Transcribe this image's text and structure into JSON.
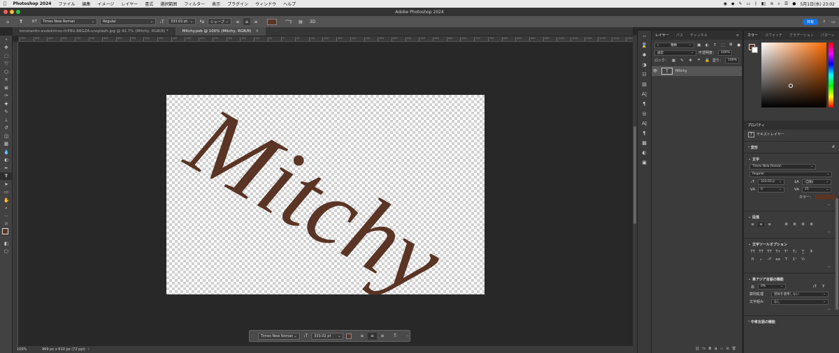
{
  "menubar": {
    "app": "Photoshop 2024",
    "items": [
      "ファイル",
      "編集",
      "イメージ",
      "レイヤー",
      "書式",
      "選択範囲",
      "フィルター",
      "表示",
      "プラグイン",
      "ウィンドウ",
      "ヘルプ"
    ],
    "datetime": "5月1日(水)  23:02"
  },
  "window": {
    "title": "Adobe Photoshop 2024"
  },
  "options": {
    "font_family": "Times New Roman",
    "font_style": "Regular",
    "font_size": "333.02 pt",
    "antialias": "シャープ",
    "text_color": "#5a3424",
    "share_label": "共有"
  },
  "tabs": [
    {
      "label": "konstantin-evdokimov-rhP8U-86GZA-unsplash.jpg @ 42.7% (Mitchy, RGB/8) *"
    },
    {
      "label": "Mitchy.psb @ 100% (Mitchy, RGB/8)"
    }
  ],
  "ruler_labels": [
    "950",
    "900",
    "850",
    "800",
    "750",
    "700",
    "650",
    "600",
    "550",
    "500",
    "450",
    "400",
    "350",
    "300",
    "250",
    "200",
    "150",
    "100",
    "50",
    "0",
    "50",
    "100",
    "150",
    "200",
    "250",
    "300",
    "350",
    "400",
    "450",
    "500",
    "550",
    "600",
    "650",
    "700",
    "750",
    "800",
    "850",
    "900",
    "950",
    "1000",
    "1050",
    "1100",
    "1150",
    "1200",
    "1250"
  ],
  "canvas": {
    "text": "Mitchy",
    "text_color": "#5a3424"
  },
  "contextbar": {
    "font_family": "Times New Roman",
    "font_size": "333.02 pt",
    "more": "···"
  },
  "status": {
    "zoom": "100%",
    "doc_info": "969 px x 610 px (72 ppi)"
  },
  "layers": {
    "tabs": [
      "レイヤー",
      "パス",
      "チャンネル"
    ],
    "kind": "種類",
    "blend_mode": "通常",
    "opacity_label": "不透明度：",
    "opacity": "100%",
    "lock_label": "ロック：",
    "fill_label": "塗り：",
    "fill": "100%",
    "layer_name": "Mitchy"
  },
  "color_panel": {
    "tabs": [
      "カラー",
      "スウォッチ",
      "グラデーション",
      "パターン"
    ]
  },
  "properties": {
    "title": "プロパティ",
    "layer_type": "テキストレイヤー",
    "transform": "変形",
    "character": "文字",
    "font_family": "Times New Roman",
    "font_style": "Regular",
    "size": "333.02 p",
    "leading": "(自動)",
    "kerning": "0",
    "tracking": "25",
    "color_label": "カラー：",
    "paragraph": "段落",
    "text_tool_options": "文字ツールオプション",
    "east_asian": "東アジア言語の機能",
    "tsume": "0%",
    "mojikumi_label": "禁則処理",
    "mojikumi_value": "禁則を使用しない",
    "mojigumi_label": "文字組み",
    "mojigumi_value": "なし",
    "middle_east": "中東言語の機能",
    "more": "···"
  }
}
